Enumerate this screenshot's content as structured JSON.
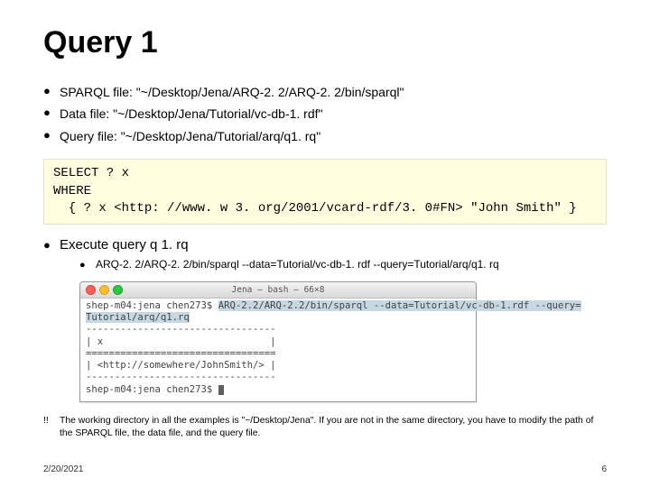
{
  "title": "Query 1",
  "files": {
    "sparql": "SPARQL file: \"~/Desktop/Jena/ARQ-2. 2/ARQ-2. 2/bin/sparql\"",
    "data": "Data file: \"~/Desktop/Jena/Tutorial/vc-db-1. rdf\"",
    "query": "Query file: \"~/Desktop/Jena/Tutorial/arq/q1. rq\""
  },
  "code": "SELECT ? x\nWHERE\n  { ? x <http: //www. w 3. org/2001/vcard-rdf/3. 0#FN> \"John Smith\" }",
  "exec_label": "Execute query q 1. rq",
  "exec_cmd": "ARQ-2. 2/ARQ-2. 2/bin/sparql --data=Tutorial/vc-db-1. rdf --query=Tutorial/arq/q1. rq",
  "terminal": {
    "caption": "Jena — bash — 66×8",
    "line1_prompt": "shep-m04:jena chen273$ ",
    "line1_cmd": "ARQ-2.2/ARQ-2.2/bin/sparql --data=Tutorial/vc-db-1.rdf --query=",
    "line2": "Tutorial/arq/q1.rq",
    "dash": "---------------------------------",
    "xhdr": "| x                             |",
    "equal": "=================================",
    "row": "| <http://somewhere/JohnSmith/> |",
    "prompt2": "shep-m04:jena chen273$ "
  },
  "note_mark": "!!",
  "note": "The working directory in all the examples is \"~/Desktop/Jena\".  If you are not in the same directory, you have to modify the path of the SPARQL file, the data file, and the query file.",
  "date": "2/20/2021",
  "page": "6"
}
